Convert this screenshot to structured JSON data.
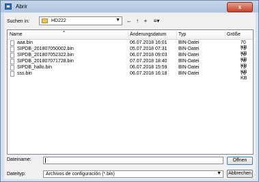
{
  "window": {
    "title": "Abrir",
    "close_label": "x"
  },
  "lookin": {
    "label": "Suchen in:",
    "value": "HD222"
  },
  "toolbar": {
    "back": "←",
    "up": "↑",
    "new_folder": "+",
    "views": "≡▾"
  },
  "columns": [
    "Name",
    "Änderungsdatum",
    "Typ",
    "Größe"
  ],
  "files": [
    {
      "name": "aaa.bin",
      "date": "06.07.2018 16:01",
      "type": "BIN-Datei",
      "size": "70 KB"
    },
    {
      "name": "SIPDB_201807050002.bin",
      "date": "05.07.2018 07:31",
      "type": "BIN-Datei",
      "size": "73 KB"
    },
    {
      "name": "SIPDB_201807052322.bin",
      "date": "06.07.2018 09:03",
      "type": "BIN-Datei",
      "size": "70 KB"
    },
    {
      "name": "SIPDB_201807071728.bin",
      "date": "07.07.2018 18:40",
      "type": "BIN-Datei",
      "size": "78 KB"
    },
    {
      "name": "SIPDB_hallo.bin",
      "date": "06.07.2018 15:59",
      "type": "BIN-Datei",
      "size": "73 KB"
    },
    {
      "name": "sss.bin",
      "date": "06.07.2018 16:18",
      "type": "BIN-Datei",
      "size": "70 KB"
    }
  ],
  "filename": {
    "label": "Dateiname:",
    "value": ""
  },
  "filetype": {
    "label": "Dateityp:",
    "value": "Archivos de configuración (*.bin)"
  },
  "buttons": {
    "open": "Öffnen",
    "cancel": "Abbrechen"
  }
}
